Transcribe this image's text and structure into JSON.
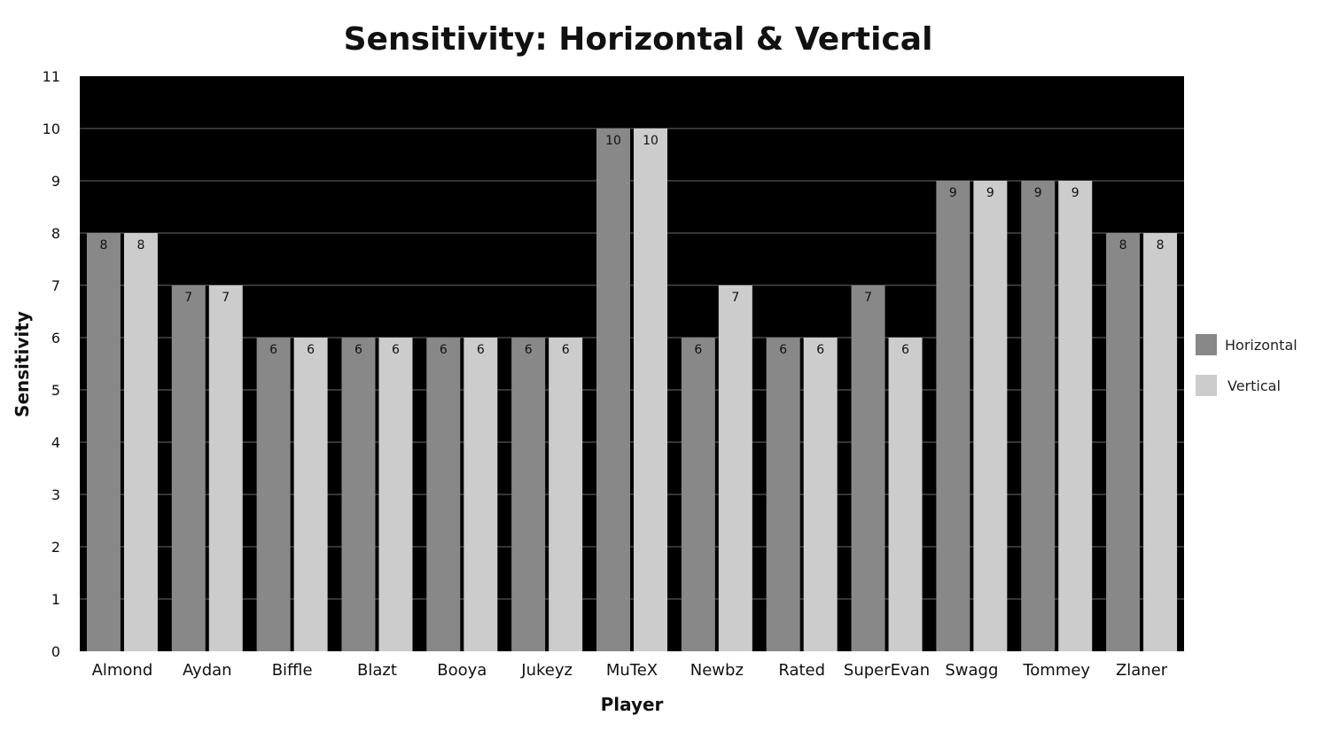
{
  "chart_data": {
    "type": "bar",
    "title": "Sensitivity: Horizontal & Vertical",
    "xlabel": "Player",
    "ylabel": "Sensitivity",
    "ylim": [
      0,
      11
    ],
    "yticks": [
      0,
      1,
      2,
      3,
      4,
      5,
      6,
      7,
      8,
      9,
      10,
      11
    ],
    "grid": true,
    "legend_position": "right",
    "plot_background": "#000000",
    "categories": [
      "Almond",
      "Aydan",
      "Biffle",
      "Blazt",
      "Booya",
      "Jukeyz",
      "MuTeX",
      "Newbz",
      "Rated",
      "SuperEvan",
      "Swagg",
      "Tommey",
      "Zlaner"
    ],
    "series": [
      {
        "name": "Horizontal",
        "color": "#888888",
        "values": [
          8,
          7,
          6,
          6,
          6,
          6,
          10,
          6,
          6,
          7,
          9,
          9,
          8
        ]
      },
      {
        "name": "Vertical",
        "color": "#cccccc",
        "values": [
          8,
          7,
          6,
          6,
          6,
          6,
          10,
          7,
          6,
          6,
          9,
          9,
          8
        ]
      }
    ],
    "data_labels": true
  }
}
